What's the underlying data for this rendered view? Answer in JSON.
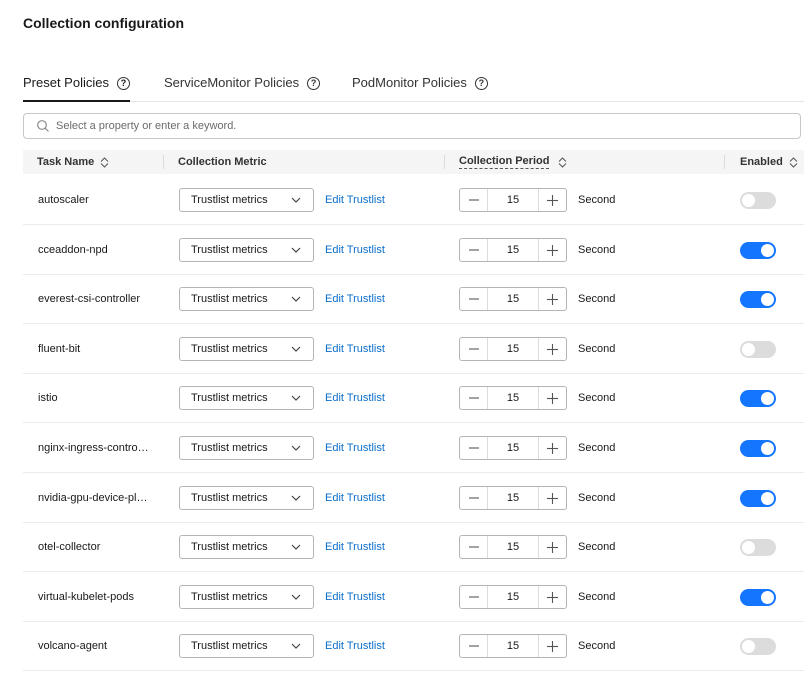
{
  "page": {
    "title": "Collection configuration"
  },
  "tabs": [
    {
      "label": "Preset Policies",
      "active": true
    },
    {
      "label": "ServiceMonitor Policies",
      "active": false
    },
    {
      "label": "PodMonitor Policies",
      "active": false
    }
  ],
  "search": {
    "placeholder": "Select a property or enter a keyword."
  },
  "table": {
    "headers": {
      "task_name": "Task Name",
      "collection_metric": "Collection Metric",
      "collection_period": "Collection Period",
      "enabled": "Enabled"
    },
    "rows": [
      {
        "name": "autoscaler",
        "metric": "Trustlist metrics",
        "link": "Edit Trustlist",
        "period": "15",
        "unit": "Second",
        "enabled": false
      },
      {
        "name": "cceaddon-npd",
        "metric": "Trustlist metrics",
        "link": "Edit Trustlist",
        "period": "15",
        "unit": "Second",
        "enabled": true
      },
      {
        "name": "everest-csi-controller",
        "metric": "Trustlist metrics",
        "link": "Edit Trustlist",
        "period": "15",
        "unit": "Second",
        "enabled": true
      },
      {
        "name": "fluent-bit",
        "metric": "Trustlist metrics",
        "link": "Edit Trustlist",
        "period": "15",
        "unit": "Second",
        "enabled": false
      },
      {
        "name": "istio",
        "metric": "Trustlist metrics",
        "link": "Edit Trustlist",
        "period": "15",
        "unit": "Second",
        "enabled": true
      },
      {
        "name": "nginx-ingress-contro…",
        "metric": "Trustlist metrics",
        "link": "Edit Trustlist",
        "period": "15",
        "unit": "Second",
        "enabled": true
      },
      {
        "name": "nvidia-gpu-device-pl…",
        "metric": "Trustlist metrics",
        "link": "Edit Trustlist",
        "period": "15",
        "unit": "Second",
        "enabled": true
      },
      {
        "name": "otel-collector",
        "metric": "Trustlist metrics",
        "link": "Edit Trustlist",
        "period": "15",
        "unit": "Second",
        "enabled": false
      },
      {
        "name": "virtual-kubelet-pods",
        "metric": "Trustlist metrics",
        "link": "Edit Trustlist",
        "period": "15",
        "unit": "Second",
        "enabled": true
      },
      {
        "name": "volcano-agent",
        "metric": "Trustlist metrics",
        "link": "Edit Trustlist",
        "period": "15",
        "unit": "Second",
        "enabled": false
      }
    ]
  },
  "icons": {
    "help": "help-circle-icon",
    "search": "search-icon",
    "sort": "sort-icon",
    "dropdown": "chevron-down-icon",
    "minus": "minus-icon",
    "plus": "plus-icon"
  },
  "colors": {
    "accent": "#1476ff",
    "link": "#0a6ecb",
    "toggle_off": "#dcdcdc"
  }
}
